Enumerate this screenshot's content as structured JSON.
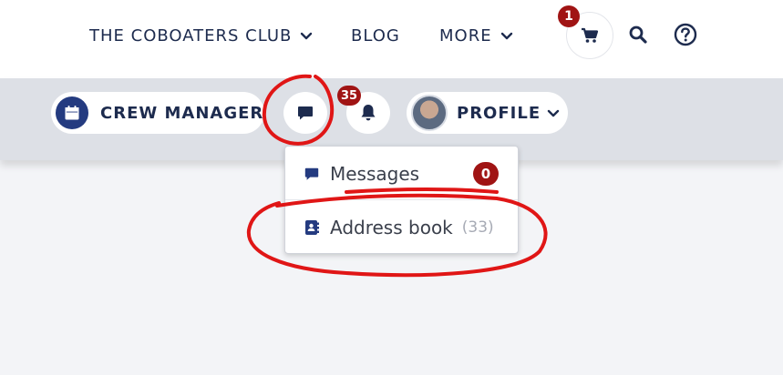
{
  "topnav": {
    "club_label": "THE COBOATERS CLUB",
    "blog_label": "BLOG",
    "more_label": "MORE",
    "cart_count": "1"
  },
  "subnav": {
    "crew_manager_label": "CREW MANAGER",
    "notifications_count": "35",
    "profile_label": "PROFILE"
  },
  "dropdown": {
    "messages_label": "Messages",
    "messages_count": "0",
    "address_book_label": "Address book",
    "address_book_count": "(33)"
  },
  "colors": {
    "navy": "#1d2b4e",
    "icon_blue": "#243b80",
    "badge_red": "#a01414",
    "annotation_red": "#e01616"
  }
}
